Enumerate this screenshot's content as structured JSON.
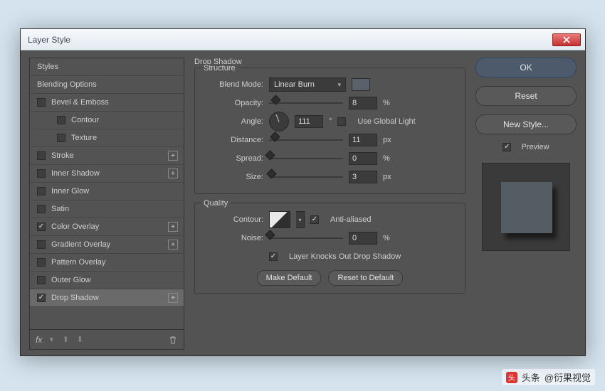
{
  "window": {
    "title": "Layer Style"
  },
  "styles": {
    "header": "Styles",
    "blending": "Blending Options",
    "items": [
      {
        "label": "Bevel & Emboss",
        "checked": false,
        "add": false
      },
      {
        "label": "Contour",
        "checked": false,
        "add": false,
        "sub": true
      },
      {
        "label": "Texture",
        "checked": false,
        "add": false,
        "sub": true
      },
      {
        "label": "Stroke",
        "checked": false,
        "add": true
      },
      {
        "label": "Inner Shadow",
        "checked": false,
        "add": true
      },
      {
        "label": "Inner Glow",
        "checked": false,
        "add": false
      },
      {
        "label": "Satin",
        "checked": false,
        "add": false
      },
      {
        "label": "Color Overlay",
        "checked": true,
        "add": true
      },
      {
        "label": "Gradient Overlay",
        "checked": false,
        "add": true
      },
      {
        "label": "Pattern Overlay",
        "checked": false,
        "add": false
      },
      {
        "label": "Outer Glow",
        "checked": false,
        "add": false
      },
      {
        "label": "Drop Shadow",
        "checked": true,
        "add": true,
        "selected": true
      }
    ],
    "footer_fx": "fx"
  },
  "panel": {
    "title": "Drop Shadow",
    "structure_label": "Structure",
    "blend_mode_label": "Blend Mode:",
    "blend_mode_value": "Linear Burn",
    "opacity_label": "Opacity:",
    "opacity_value": "8",
    "opacity_unit": "%",
    "angle_label": "Angle:",
    "angle_value": "111",
    "angle_unit": "°",
    "use_global_label": "Use Global Light",
    "use_global_checked": false,
    "distance_label": "Distance:",
    "distance_value": "11",
    "distance_unit": "px",
    "spread_label": "Spread:",
    "spread_value": "0",
    "spread_unit": "%",
    "size_label": "Size:",
    "size_value": "3",
    "size_unit": "px",
    "quality_label": "Quality",
    "contour_label": "Contour:",
    "antialias_label": "Anti-aliased",
    "antialias_checked": true,
    "noise_label": "Noise:",
    "noise_value": "0",
    "noise_unit": "%",
    "knockout_label": "Layer Knocks Out Drop Shadow",
    "knockout_checked": true,
    "make_default": "Make Default",
    "reset_default": "Reset to Default"
  },
  "right": {
    "ok": "OK",
    "reset": "Reset",
    "new_style": "New Style...",
    "preview_label": "Preview",
    "preview_checked": true
  },
  "watermark": {
    "brand": "头条",
    "text": "@衍果视觉"
  }
}
